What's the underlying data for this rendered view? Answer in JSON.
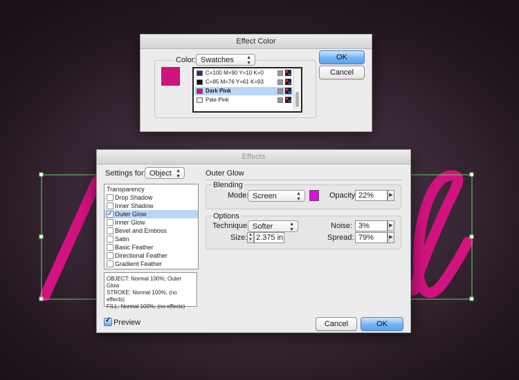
{
  "colors": {
    "dark_pink": "#d2127f",
    "glow_swatch": "#d911d9",
    "selection_frame": "#6fd36f",
    "accent_blue": "#5ea3ef"
  },
  "effect_color_dialog": {
    "title": "Effect Color",
    "color_label": "Color:",
    "color_source": "Swatches",
    "ok_label": "OK",
    "cancel_label": "Cancel",
    "swatches": [
      {
        "name": "C=100 M=90 Y=10 K=0",
        "color": "#2a2f7a"
      },
      {
        "name": "C=85 M=76 Y=61 K=93",
        "color": "#0b0b0d"
      },
      {
        "name": "Dark Pink",
        "color": "#d2127f"
      },
      {
        "name": "Pale Pink",
        "color": "#f6e6ef"
      }
    ]
  },
  "effects_dialog": {
    "title": "Effects",
    "settings_for_label": "Settings for:",
    "settings_for_value": "Object",
    "effects_list": [
      {
        "name": "Transparency",
        "checkbox": false,
        "checked": false,
        "selected": false
      },
      {
        "name": "Drop Shadow",
        "checkbox": true,
        "checked": false,
        "selected": false
      },
      {
        "name": "Inner Shadow",
        "checkbox": true,
        "checked": false,
        "selected": false
      },
      {
        "name": "Outer Glow",
        "checkbox": true,
        "checked": true,
        "selected": true
      },
      {
        "name": "Inner Glow",
        "checkbox": true,
        "checked": false,
        "selected": false
      },
      {
        "name": "Bevel and Emboss",
        "checkbox": true,
        "checked": false,
        "selected": false
      },
      {
        "name": "Satin",
        "checkbox": true,
        "checked": false,
        "selected": false
      },
      {
        "name": "Basic Feather",
        "checkbox": true,
        "checked": false,
        "selected": false
      },
      {
        "name": "Directional Feather",
        "checkbox": true,
        "checked": false,
        "selected": false
      },
      {
        "name": "Gradient Feather",
        "checkbox": true,
        "checked": false,
        "selected": false
      }
    ],
    "summary": [
      "OBJECT: Normal 100%; Outer Glow",
      "STROKE: Normal 100%; (no effects)",
      "FILL: Normal 100%; (no effects)"
    ],
    "section_title": "Outer Glow",
    "blending": {
      "title": "Blending",
      "mode_label": "Mode:",
      "mode_value": "Screen",
      "opacity_label": "Opacity:",
      "opacity_value": "22%"
    },
    "options": {
      "title": "Options",
      "technique_label": "Technique:",
      "technique_value": "Softer",
      "size_label": "Size:",
      "size_value": "2.375 in",
      "noise_label": "Noise:",
      "noise_value": "3%",
      "spread_label": "Spread:",
      "spread_value": "79%"
    },
    "preview_label": "Preview",
    "preview_checked": true,
    "cancel_label": "Cancel",
    "ok_label": "OK"
  }
}
